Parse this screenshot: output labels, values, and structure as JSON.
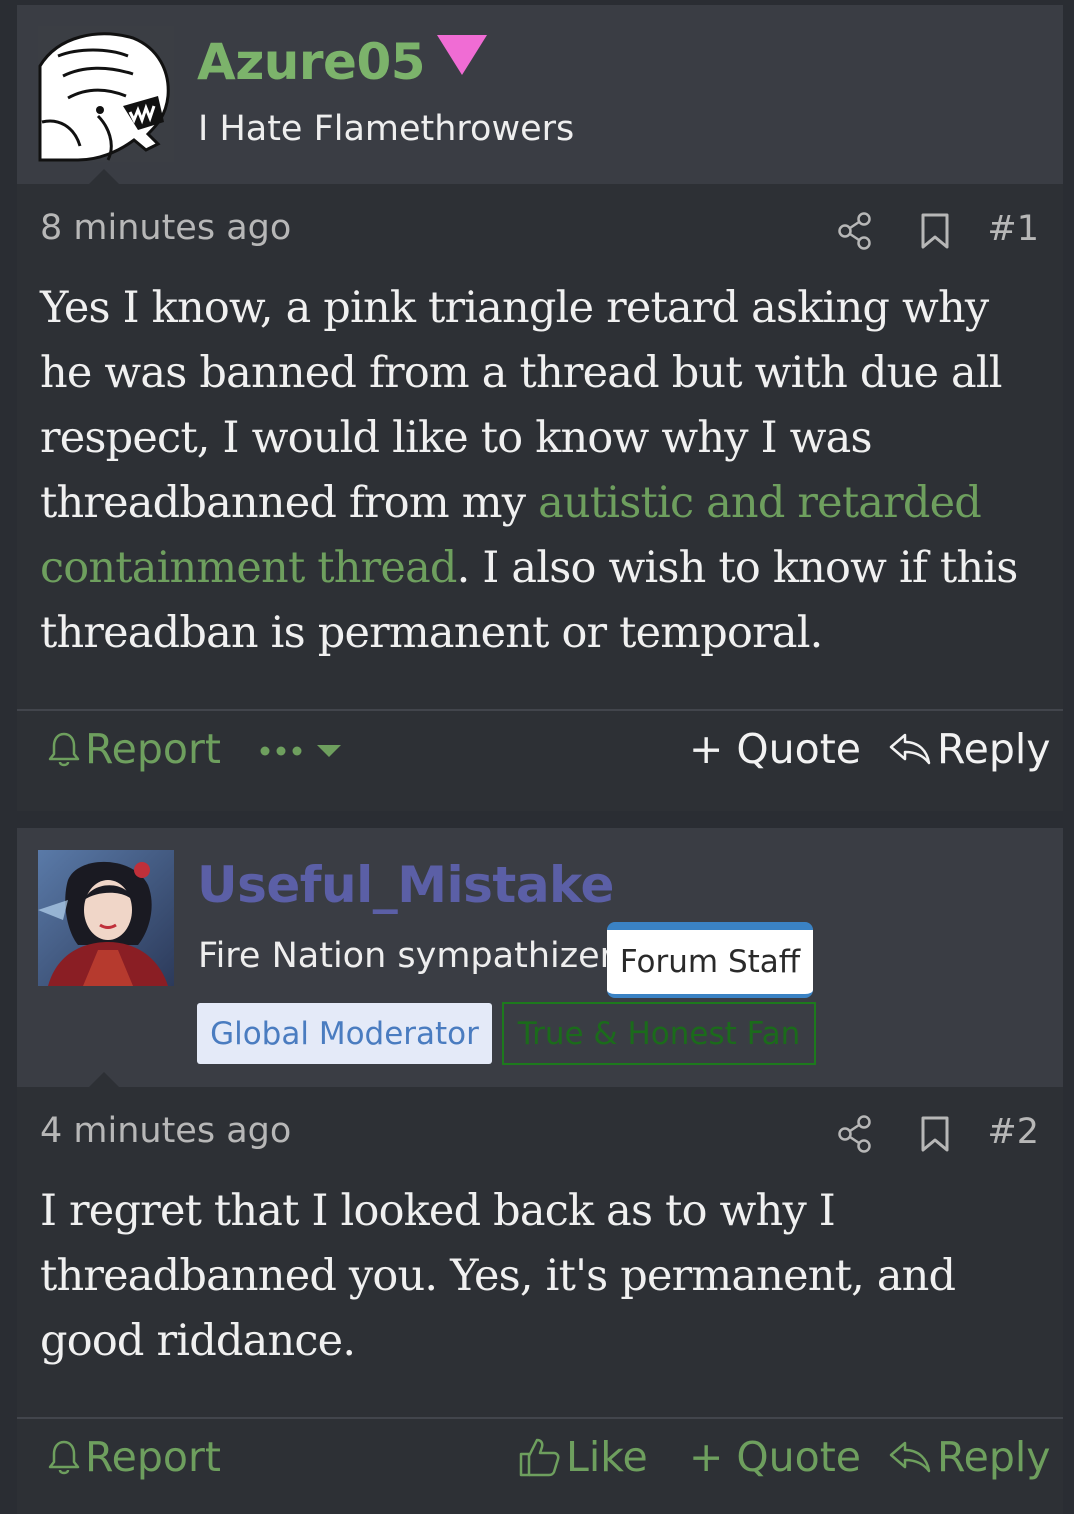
{
  "colors": {
    "page_bg": "#2a2d33",
    "post_header_bg": "#3a3d44",
    "post_body_bg": "#2d3035",
    "username_green": "#7cb36b",
    "username_purple": "#5b5fa6",
    "link_green": "#6e9f5e",
    "pink_triangle": "#f06cd4"
  },
  "posts": [
    {
      "username": "Azure05",
      "user_title": "I Hate Flamethrowers",
      "avatar_icon": "xenomorph-avatar",
      "timestamp": "8 minutes ago",
      "post_number": "#1",
      "content_parts": [
        "Yes I know, a pink triangle retard asking why he was banned from a thread but with due all respect, I would like to know why I was threadbanned from my ",
        "autistic and retarded containment thread",
        ". I also wish to know if this threadban is permanent or temporal."
      ],
      "actions": {
        "report": "Report",
        "quote": "+ Quote",
        "reply": "Reply"
      }
    },
    {
      "username": "Useful_Mistake",
      "user_title": "Fire Nation sympathizer",
      "avatar_icon": "anime-avatar",
      "badges": {
        "staff": "Forum Staff",
        "global_mod": "Global Moderator",
        "fan": "True & Honest Fan"
      },
      "timestamp": "4 minutes ago",
      "post_number": "#2",
      "content": "I regret that I looked back as to why I threadbanned you. Yes, it's permanent, and good riddance.",
      "actions": {
        "report": "Report",
        "like": "Like",
        "quote": "+ Quote",
        "reply": "Reply"
      }
    }
  ]
}
